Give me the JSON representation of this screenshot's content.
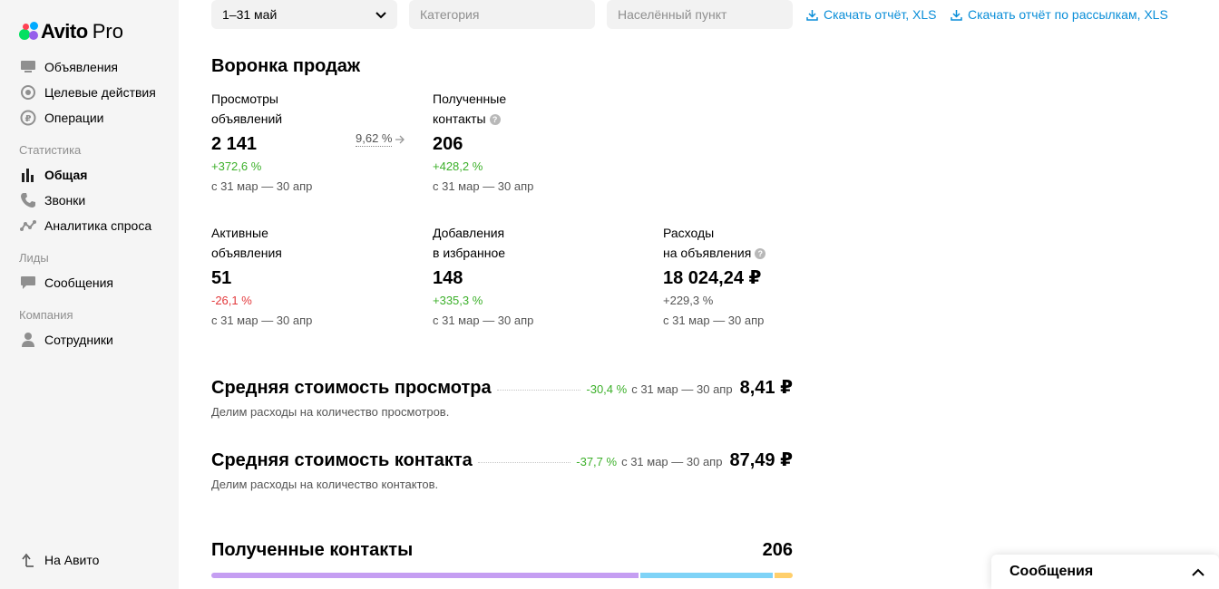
{
  "brand": {
    "name": "Avito",
    "suffix": "Pro"
  },
  "sidebar": {
    "items": [
      {
        "label": "Объявления",
        "icon": "listings-icon"
      },
      {
        "label": "Целевые действия",
        "icon": "target-icon"
      },
      {
        "label": "Операции",
        "icon": "ruble-icon"
      }
    ],
    "stats_section": "Статистика",
    "stats_items": [
      {
        "label": "Общая",
        "icon": "bar-chart-icon",
        "active": true
      },
      {
        "label": "Звонки",
        "icon": "phone-icon"
      },
      {
        "label": "Аналитика спроса",
        "icon": "analytics-icon"
      }
    ],
    "leads_section": "Лиды",
    "leads_items": [
      {
        "label": "Сообщения",
        "icon": "chat-icon"
      }
    ],
    "company_section": "Компания",
    "company_items": [
      {
        "label": "Сотрудники",
        "icon": "user-icon"
      }
    ],
    "back_link": "На Авито"
  },
  "filters": {
    "period": "1–31 май",
    "category_placeholder": "Категория",
    "location_placeholder": "Населённый пункт",
    "download_xls": "Скачать отчёт, XLS",
    "download_mailing_xls": "Скачать отчёт по рассылкам, XLS"
  },
  "funnel": {
    "title": "Воронка продаж",
    "conversion": "9,62 %",
    "views": {
      "label1": "Просмотры",
      "label2": "объявлений",
      "value": "2 141",
      "change": "+372,6 %",
      "period": "с 31 мар — 30 апр"
    },
    "contacts": {
      "label1": "Полученные",
      "label2": "контакты",
      "value": "206",
      "change": "+428,2 %",
      "period": "с 31 мар — 30 апр"
    },
    "active": {
      "label1": "Активные",
      "label2": "объявления",
      "value": "51",
      "change": "-26,1 %",
      "period": "с 31 мар — 30 апр"
    },
    "favorites": {
      "label1": "Добавления",
      "label2": "в избранное",
      "value": "148",
      "change": "+335,3 %",
      "period": "с 31 мар — 30 апр"
    },
    "expenses": {
      "label1": "Расходы",
      "label2": "на объявления",
      "value": "18 024,24 ₽",
      "change": "+229,3 %",
      "period": "с 31 мар — 30 апр"
    }
  },
  "avg_view_cost": {
    "title": "Средняя стоимость просмотра",
    "change": "-30,4 %",
    "period": "с 31 мар — 30 апр",
    "value": "8,41 ₽",
    "description": "Делим расходы на количество просмотров."
  },
  "avg_contact_cost": {
    "title": "Средняя стоимость контакта",
    "change": "-37,7 %",
    "period": "с 31 мар — 30 апр",
    "value": "87,49 ₽",
    "description": "Делим расходы на количество контактов."
  },
  "received_contacts": {
    "title": "Полученные контакты",
    "total": "206",
    "segments": [
      {
        "fraction": 0.735,
        "color": "#c59ef2"
      },
      {
        "fraction": 0.23,
        "color": "#7fd3f7"
      },
      {
        "fraction": 0.035,
        "color": "#ffcf6b"
      }
    ]
  },
  "messages_panel": {
    "title": "Сообщения"
  }
}
